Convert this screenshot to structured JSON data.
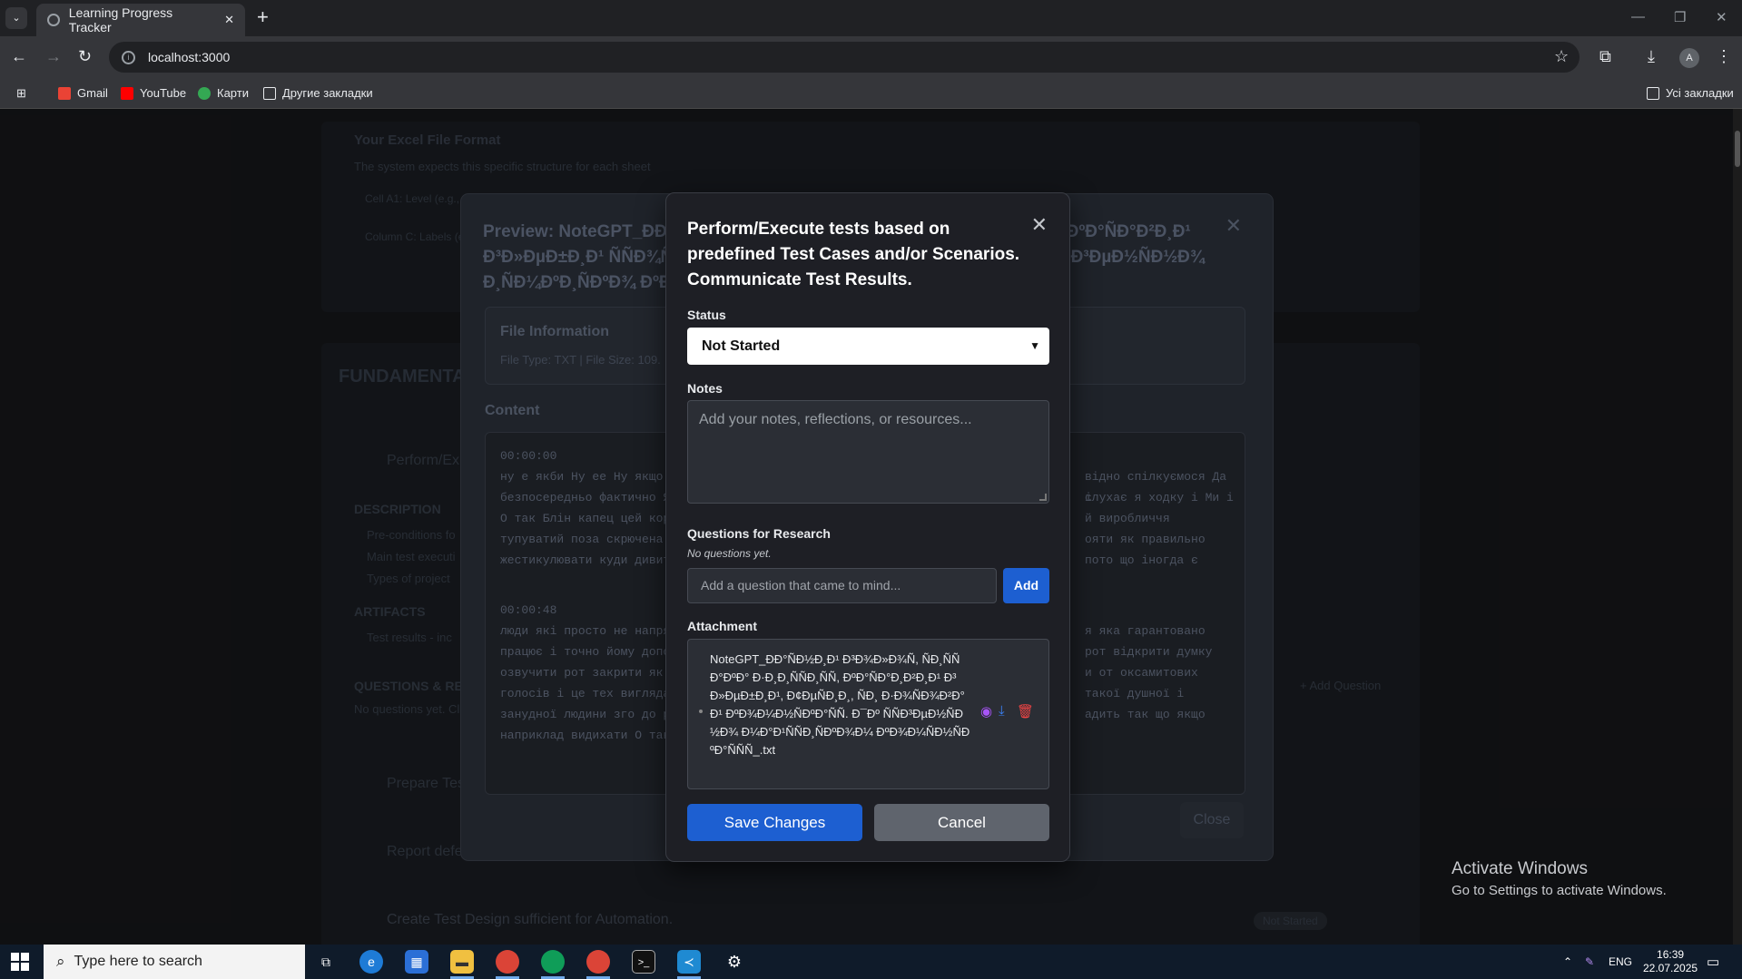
{
  "browser": {
    "tab_title": "Learning Progress Tracker",
    "url": "localhost:3000",
    "bookmarks": [
      "Gmail",
      "YouTube",
      "Карти",
      "Другие закладки"
    ],
    "all_bookmarks": "Усі закладки",
    "profile_initial": "A"
  },
  "background": {
    "format_title": "Your Excel File Format",
    "format_sub": "The system expects this specific structure for each sheet",
    "cell_a1": "Cell A1: Level (e.g.,",
    "column_c": "Column C: Labels (e.g.",
    "section_title": "FUNDAMENTA",
    "item1": "Perform/Ex",
    "description": "DESCRIPTION",
    "desc_items": [
      "Pre-conditions fo",
      "Main test executi",
      "Types of project"
    ],
    "artifacts": "ARTIFACTS",
    "artifact_item": "Test results - inc",
    "questions": "QUESTIONS & RE",
    "no_questions": "No questions yet. Clic",
    "add_question": "+ Add Question",
    "item2": "Prepare Tes",
    "item3": "Report defe",
    "item4": "Create Test Design sufficient for Automation.",
    "badge": "Not Started",
    "badge_short": "Started"
  },
  "preview": {
    "title": "Preview: NoteGPT_ÐÐ°ÑÐ½Ð¸Ð¹ ÐÐ¾Ð»ÑÐ¸ ÐºÑÐ°ÑÐºÐ° Ð·Ð¸ÑÑÐ¸ÑÑ ÐºÐ°ÑÐ°Ð²Ð¸Ð¹ Ð³Ð»ÐµÐ±Ð¸Ð¹ ÑÑÐ¾ÑÐ¶ÐµÐ½Ð¸Ð¹ ÐÐ¾Ð¹Ð¼ÐºÐ½ÑÐºÐ°ÑÑ. Ð¯Ðº ÑÑÐ³ÐµÐ½ÑÐ½Ð¾ Ð¸ÑÐ¼ÐºÐ¸ÑÐºÐ¾ ÐºÐ¾Ð¼ÑÐ½ÑÐºÐ°ÑÑÑ",
    "file_info_title": "File Information",
    "file_info": "File Type: TXT | File Size: 109.",
    "content_label": "Content",
    "ts1": "00:00:00",
    "lines1_left": [
      "ну е якби Ну ее Ну якщо",
      "безпосередньо фактично Я",
      "О так Блін капец цей кор",
      "тупуватий поза скрючена",
      "жестикулювати куди дивит"
    ],
    "lines1_right": [
      "відно спілкуємося Да і",
      "слухає я ходку і Ми і",
      "й виробличчя",
      "ояти як правильно",
      " пото що іногда є"
    ],
    "ts2": "00:00:48",
    "lines2_left": [
      "люди які просто не напря",
      "працює і точно йому допо",
      "озвучити рот закрити як",
      "голосів і це тех вигляда",
      "занудної людини зго до р",
      "наприклад видихати О так"
    ],
    "lines2_right": [
      "я яка гарантовано",
      " рот відкрити думку",
      "и от оксамитових",
      "такої душної і",
      "адить так що якщо",
      ""
    ],
    "close": "Close"
  },
  "modal": {
    "title": "Perform/Execute tests based on predefined Test Cases and/or Scenarios. Communicate Test Results.",
    "status_label": "Status",
    "status_value": "Not Started",
    "notes_label": "Notes",
    "notes_placeholder": "Add your notes, reflections, or resources...",
    "questions_label": "Questions for Research",
    "no_questions": "No questions yet.",
    "question_placeholder": "Add a question that came to mind...",
    "add_label": "Add",
    "attachment_label": "Attachment",
    "attachment_name": "NoteGPT_ÐÐ°ÑÐ½Ð¸Ð¹ Ð³Ð¾Ð»Ð¾Ñ, ÑÐ¸ÑÑÐ°ÐºÐ° Ð·Ð¸Ð¸ÑÑÐ¸ÑÑ, ÐºÐ°ÑÐ°Ð¸Ð²Ð¸Ð¹ Ð³Ð»ÐµÐ±Ð¸Ð¹, Ð¢ÐµÑÐ¸Ð¸, ÑÐ¸ Ð·Ð¾ÑÐ¾Ð²Ð°Ð¹ ÐºÐ¾Ð¼Ð½ÑÐºÐ°ÑÑ. Ð¯Ðº ÑÑÐ³ÐµÐ½ÑÐ½Ð¾ Ð¼Ð°Ð¹ÑÑÐ¸ÑÐºÐ¾Ð¼ ÐºÐ¾Ð¼ÑÐ½ÑÐºÐ°ÑÑÑ_.txt",
    "save_label": "Save Changes",
    "cancel_label": "Cancel"
  },
  "windows": {
    "activate_title": "Activate Windows",
    "activate_sub": "Go to Settings to activate Windows.",
    "search_placeholder": "Type here to search",
    "lang": "ENG",
    "time": "16:39",
    "date": "22.07.2025"
  },
  "colors": {
    "primary_button": "#1d5fd1",
    "cancel_button": "#5f646d",
    "modal_bg": "#1e1f25",
    "view_icon": "#a855f7",
    "download_icon": "#3b82f6",
    "delete_icon": "#ef4444"
  }
}
